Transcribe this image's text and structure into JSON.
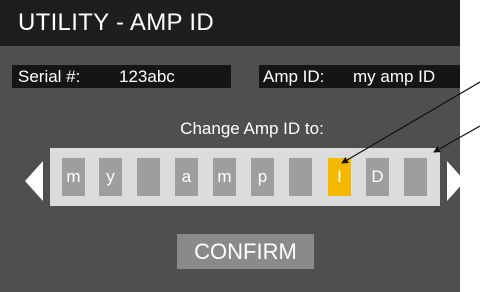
{
  "header": {
    "title": "UTILITY - AMP ID"
  },
  "serial": {
    "label": "Serial #:",
    "value": "123abc"
  },
  "amp_id": {
    "label": "Amp ID:",
    "value": "my amp ID"
  },
  "editor": {
    "prompt": "Change Amp ID to:",
    "slots": [
      {
        "char": "m"
      },
      {
        "char": "y"
      },
      {
        "char": ""
      },
      {
        "char": "a"
      },
      {
        "char": "m"
      },
      {
        "char": "p"
      },
      {
        "char": ""
      },
      {
        "char": "I",
        "selected": true
      },
      {
        "char": "D"
      },
      {
        "char": ""
      }
    ]
  },
  "actions": {
    "confirm_label": "CONFIRM"
  },
  "icons": {
    "left": "chevron-left-icon",
    "right": "chevron-right-icon"
  },
  "colors": {
    "title_bar": "#1e1e1e",
    "background": "#4f4f4f",
    "strip": "#dcdcdc",
    "slot": "#9e9e9e",
    "selected_slot": "#f5b800",
    "button": "#8a8a8a"
  }
}
